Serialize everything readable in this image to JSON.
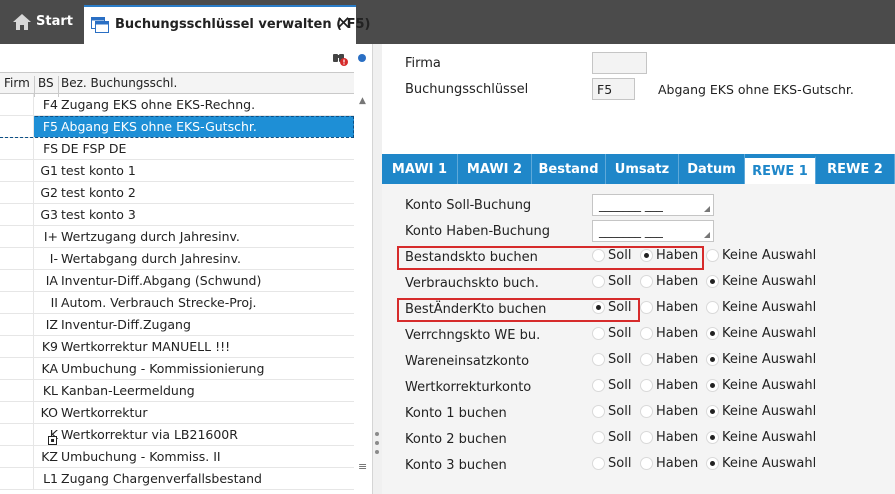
{
  "tabbar": {
    "start_label": "Start",
    "active_tab_label": "Buchungsschlüssel verwalten ( F5)",
    "close_glyph": "✕"
  },
  "grid": {
    "headers": {
      "firm": "Firm",
      "bs": "BS",
      "bez": "Bez. Buchungsschl."
    },
    "rows": [
      {
        "bs": "F4",
        "bez": "Zugang EKS ohne EKS-Rechng."
      },
      {
        "bs": "F5",
        "bez": "Abgang EKS ohne EKS-Gutschr.",
        "selected": true
      },
      {
        "bs": "FS",
        "bez": "DE FSP DE"
      },
      {
        "bs": "G1",
        "bez": "test konto 1"
      },
      {
        "bs": "G2",
        "bez": "test konto 2"
      },
      {
        "bs": "G3",
        "bez": "test konto 3"
      },
      {
        "bs": "I+",
        "bez": "Wertzugang durch Jahresinv."
      },
      {
        "bs": "I-",
        "bez": "Wertabgang durch Jahresinv."
      },
      {
        "bs": "IA",
        "bez": "Inventur-Diff.Abgang (Schwund)"
      },
      {
        "bs": "II",
        "bez": "Autom. Verbrauch Strecke-Proj."
      },
      {
        "bs": "IZ",
        "bez": "Inventur-Diff.Zugang"
      },
      {
        "bs": "K9",
        "bez": "Wertkorrektur MANUELL !!!"
      },
      {
        "bs": "KA",
        "bez": "Umbuchung - Kommissionierung"
      },
      {
        "bs": "KL",
        "bez": "Kanban-Leermeldung"
      },
      {
        "bs": "KO",
        "bez": "Wertkorrektur"
      },
      {
        "bs": "K",
        "bez": "Wertkorrektur via LB21600R",
        "icon": "lock-icon"
      },
      {
        "bs": "KZ",
        "bez": "Umbuchung - Kommiss. II"
      },
      {
        "bs": "L1",
        "bez": "Zugang Chargenverfallsbestand"
      }
    ]
  },
  "form": {
    "firma_label": "Firma",
    "firma_value": "",
    "bs_label": "Buchungsschlüssel",
    "bs_value": "F5",
    "bs_description": "Abgang EKS ohne EKS-Gutschr."
  },
  "tabs": [
    {
      "label": "MAWI 1"
    },
    {
      "label": "MAWI 2"
    },
    {
      "label": "Bestand"
    },
    {
      "label": "Umsatz"
    },
    {
      "label": "Datum"
    },
    {
      "label": "REWE 1",
      "active": true
    },
    {
      "label": "REWE 2"
    }
  ],
  "rewe1": {
    "konto_soll_label": "Konto Soll-Buchung",
    "konto_soll_value": "_______ ___",
    "konto_haben_label": "Konto Haben-Buchung",
    "konto_haben_value": "_______ ___",
    "options": {
      "soll": "Soll",
      "haben": "Haben",
      "keine": "Keine Auswahl"
    },
    "rows": [
      {
        "label": "Bestandskto buchen",
        "selected": "haben",
        "highlight": true
      },
      {
        "label": "Verbrauchskto buch.",
        "selected": "keine"
      },
      {
        "label": "BestÄnderKto buchen",
        "selected": "soll",
        "highlight": true
      },
      {
        "label": "Verrchngskto WE bu.",
        "selected": "keine"
      },
      {
        "label": "Wareneinsatzkonto",
        "selected": "keine"
      },
      {
        "label": "Wertkorrekturkonto",
        "selected": "keine"
      },
      {
        "label": "Konto 1 buchen",
        "selected": "keine"
      },
      {
        "label": "Konto 2 buchen",
        "selected": "keine"
      },
      {
        "label": "Konto 3 buchen",
        "selected": "keine"
      }
    ]
  },
  "colors": {
    "tabbar_bg": "#4b4b4b",
    "accent_blue": "#1f87c9",
    "selection_blue": "#1e8fd6",
    "highlight_red": "#d62b2b"
  }
}
